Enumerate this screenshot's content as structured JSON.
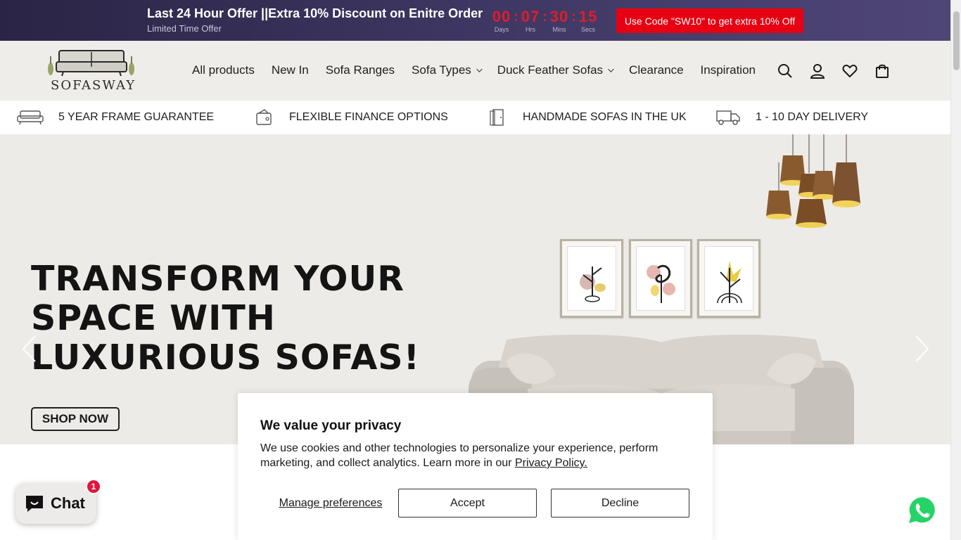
{
  "announcement": {
    "title": "Last 24 Hour Offer ||Extra 10% Discount on Enitre Order",
    "subtitle": "Limited Time Offer",
    "countdown": [
      {
        "value": "00",
        "label": "Days"
      },
      {
        "value": "07",
        "label": "Hrs"
      },
      {
        "value": "30",
        "label": "Mins"
      },
      {
        "value": "15",
        "label": "Secs"
      }
    ],
    "code_button": "Use Code \"SW10\" to get extra 10% Off"
  },
  "header": {
    "logo_text": "SOFASWAY",
    "nav": [
      {
        "label": "All products",
        "dropdown": false
      },
      {
        "label": "New In",
        "dropdown": false
      },
      {
        "label": "Sofa Ranges",
        "dropdown": false
      },
      {
        "label": "Sofa Types",
        "dropdown": true
      },
      {
        "label": "Duck Feather Sofas",
        "dropdown": true
      },
      {
        "label": "Clearance",
        "dropdown": false
      },
      {
        "label": "Inspiration",
        "dropdown": false
      }
    ],
    "icons": [
      "search-icon",
      "account-icon",
      "wishlist-heart-icon",
      "cart-bag-icon"
    ]
  },
  "features": [
    {
      "icon": "sofa-icon",
      "label": "5 YEAR FRAME GUARANTEE"
    },
    {
      "icon": "wallet-icon",
      "label": "FLEXIBLE FINANCE OPTIONS"
    },
    {
      "icon": "door-icon",
      "label": "HANDMADE SOFAS IN THE UK"
    },
    {
      "icon": "delivery-truck-icon",
      "label": "1 - 10 DAY DELIVERY"
    }
  ],
  "hero": {
    "title_lines": [
      "TRANSFORM YOUR",
      "SPACE WITH",
      "LUXURIOUS SOFAS!"
    ],
    "cta": "SHOP NOW"
  },
  "chat": {
    "label": "Chat",
    "badge": "1"
  },
  "privacy": {
    "title": "We value your privacy",
    "text": "We use cookies and other technologies to personalize your experience, perform marketing, and collect analytics. Learn more in our ",
    "link": "Privacy Policy.",
    "manage": "Manage preferences",
    "accept": "Accept",
    "decline": "Decline"
  },
  "colors": {
    "accent_red": "#e60012",
    "topbar_purple": "#3e3763",
    "header_bg": "#efede9"
  }
}
